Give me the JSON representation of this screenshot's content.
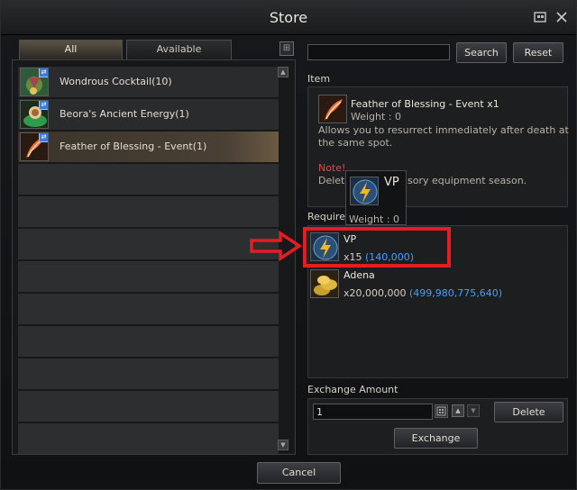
{
  "window": {
    "title": "Store"
  },
  "tabs": [
    {
      "label": "All"
    },
    {
      "label": "Available"
    }
  ],
  "items": [
    {
      "name": "Wondrous Cocktail(10)"
    },
    {
      "name": "Beora's Ancient Energy(1)"
    },
    {
      "name": "Feather of Blessing - Event(1)"
    }
  ],
  "toolbar": {
    "search_label": "Search",
    "reset_label": "Reset",
    "search_value": ""
  },
  "detail": {
    "section_label": "Item",
    "name": "Feather of Blessing - Event x1",
    "weight_label": "Weight :",
    "weight_value": "0",
    "desc_line1": "Allows you to resurrect immediately after death at",
    "desc_line2": "the same spot.",
    "note_label": "Note!",
    "note_text_start": "Delet",
    "note_text_end": "sory equipment season."
  },
  "tooltip": {
    "name": "VP",
    "weight_label": "Weight :",
    "weight_value": "0"
  },
  "requirements": {
    "section_label": "Requirem",
    "items": [
      {
        "name": "VP",
        "qty": "x15",
        "owned": "(140,000)"
      },
      {
        "name": "Adena",
        "qty": "x20,000,000",
        "owned": "(499,980,775,640)"
      }
    ]
  },
  "exchange": {
    "section_label": "Exchange Amount",
    "amount": "1",
    "delete_label": "Delete",
    "exchange_label": "Exchange"
  },
  "footer": {
    "cancel_label": "Cancel"
  },
  "colors": {
    "highlight": "#e41c24",
    "owned": "#3fa2ff",
    "note": "#e64545"
  }
}
